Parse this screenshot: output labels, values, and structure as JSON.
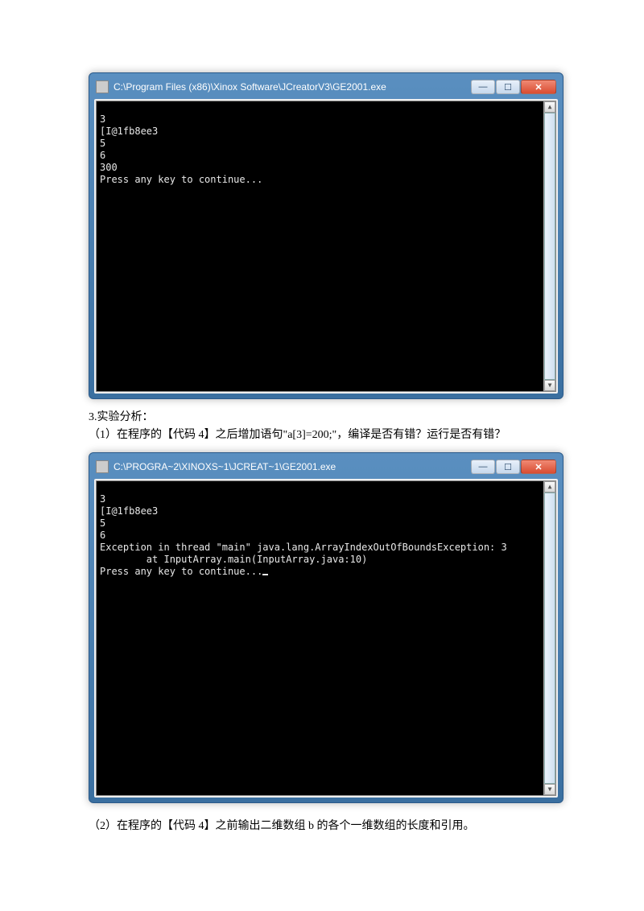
{
  "window1": {
    "title": "C:\\Program Files (x86)\\Xinox Software\\JCreatorV3\\GE2001.exe",
    "console": "3\n[I@1fb8ee3\n5\n6\n300\nPress any key to continue..."
  },
  "section3": {
    "heading": "3.实验分析：",
    "item1": "（1）在程序的【代码 4】之后增加语句\"a[3]=200;\"，编译是否有错？运行是否有错？"
  },
  "window2": {
    "title": "C:\\PROGRA~2\\XINOXS~1\\JCREAT~1\\GE2001.exe",
    "console": "3\n[I@1fb8ee3\n5\n6\nException in thread \"main\" java.lang.ArrayIndexOutOfBoundsException: 3\n        at InputArray.main(InputArray.java:10)\nPress any key to continue..."
  },
  "section_item2": {
    "text": "（2）在程序的【代码 4】之前输出二维数组 b 的各个一维数组的长度和引用。"
  },
  "buttons": {
    "min_glyph": "—",
    "max_glyph": "☐",
    "close_glyph": "✕",
    "up_glyph": "▲",
    "down_glyph": "▼"
  }
}
